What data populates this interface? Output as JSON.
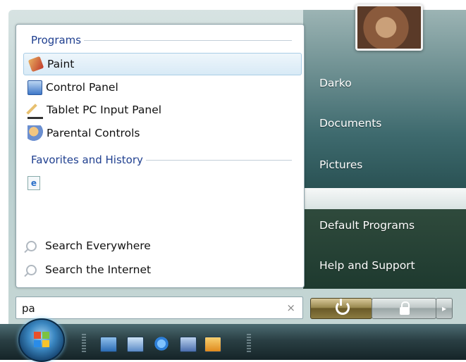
{
  "left_pane": {
    "programs_heading": "Programs",
    "programs": [
      {
        "label": "Paint",
        "icon": "paint-icon",
        "selected": true
      },
      {
        "label": "Control Panel",
        "icon": "control-panel-icon",
        "selected": false
      },
      {
        "label": "Tablet PC Input Panel",
        "icon": "tablet-pc-input-panel-icon",
        "selected": false
      },
      {
        "label": "Parental Controls",
        "icon": "parental-controls-icon",
        "selected": false
      }
    ],
    "favorites_heading": "Favorites and History",
    "favorites_icon": "internet-explorer-icon",
    "search_everywhere": "Search Everywhere",
    "search_internet": "Search the Internet"
  },
  "search": {
    "value": "pa",
    "clear_symbol": "×"
  },
  "right_pane": {
    "user_name": "Darko",
    "documents": "Documents",
    "pictures": "Pictures",
    "default_programs": "Default Programs",
    "help_support": "Help and Support"
  },
  "power_controls": {
    "power_icon": "power-icon",
    "lock_icon": "lock-icon",
    "arrow_symbol": "▸"
  },
  "taskbar": {
    "start_icon": "windows-logo-icon",
    "quick_launch": [
      "show-desktop-icon",
      "switch-windows-icon",
      "internet-explorer-icon",
      "windows-media-center-icon",
      "media-player-icon"
    ]
  },
  "colors": {
    "heading_blue": "#1f3f8f",
    "selected_highlight": "#d8eaf6",
    "right_pane_teal": "#3e6a6e",
    "power_gold": "#9a8a50"
  }
}
